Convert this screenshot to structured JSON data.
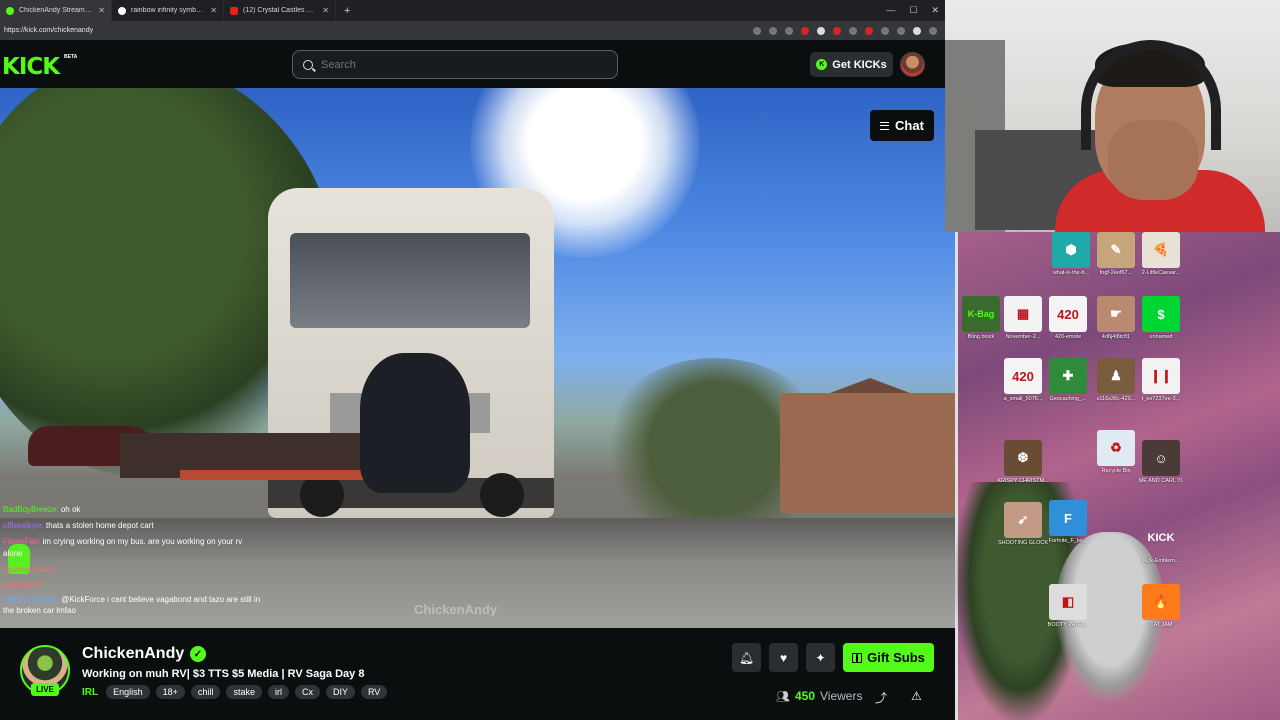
{
  "browser": {
    "tabs": [
      {
        "label": "ChickenAndy Stream - Watch",
        "active": true
      },
      {
        "label": "rainbow infinity symbol - Google",
        "active": false
      },
      {
        "label": "(12) Crystal Castles First Album M",
        "active": false
      }
    ],
    "url": "https://kick.com/chickenandy"
  },
  "header": {
    "logo": "KICK",
    "beta": "BETA",
    "search_placeholder": "Search",
    "get_kicks": "Get KICKs"
  },
  "player": {
    "chat_button": "Chat",
    "watermark": "ChickenAndy",
    "overlay_chat": [
      {
        "user": "BadBoyBreeze:",
        "msg": "oh ok"
      },
      {
        "user": "offbeatkyle:",
        "msg": "thats a stolen home depot cart"
      },
      {
        "user": "FlexieFae:",
        "msg": "im crying working on my bus. are you working on your rv alone"
      },
      {
        "user": "QuartaQuinco:",
        "msg": ""
      },
      {
        "user": "KoKoWOO:",
        "msg": ""
      },
      {
        "user": "SNEAKYWIND:",
        "msg": "@KickForce i cant believe vagabond and tazo are still in the broken car lmfao"
      }
    ]
  },
  "stream": {
    "live_badge": "LIVE",
    "streamer": "ChickenAndy",
    "title": "Working on muh RV| $3 TTS $5 Media | RV Saga Day 8",
    "category": "IRL",
    "tags": [
      "English",
      "18+",
      "chill",
      "stake",
      "irl",
      "Cx",
      "DIY",
      "RV"
    ],
    "gift_subs": "Gift Subs",
    "viewers_count": "450",
    "viewers_label": "Viewers"
  },
  "desktop": {
    "icons": [
      {
        "caption": "what-is-the-b...",
        "glyph": "⬢",
        "color": "#1fa9a9"
      },
      {
        "caption": "fogf-2eef67...",
        "glyph": "✎",
        "color": "#c7a57a"
      },
      {
        "caption": "2-LittleCaesar...",
        "glyph": "🍕",
        "color": "#e8e1d8"
      },
      {
        "caption": "Bling block",
        "glyph": "K-Bag",
        "color": "#3a6b2e"
      },
      {
        "caption": "November-2...",
        "glyph": "▦",
        "color": "#f3f3f3"
      },
      {
        "caption": "420-emote",
        "glyph": "420",
        "color": "#f4f4f4"
      },
      {
        "caption": "4d6j4t8tcft1",
        "glyph": "☛",
        "color": "#b98a6f"
      },
      {
        "caption": "unnamed",
        "glyph": "$",
        "color": "#00d632"
      },
      {
        "caption": "a_small_5076...",
        "glyph": "420",
        "color": "#f4f4f4"
      },
      {
        "caption": "Geocaching_...",
        "glyph": "✚",
        "color": "#2f8a3c"
      },
      {
        "caption": "s116s36c-420...",
        "glyph": "♟",
        "color": "#7a5c3e"
      },
      {
        "caption": "t_ee7237ee-3...",
        "glyph": "❙❙",
        "color": "#f2f2f2"
      },
      {
        "caption": "KRISPY CHRISTM...",
        "glyph": "❆",
        "color": "#6a4b34"
      },
      {
        "caption": "Recycle Bin",
        "glyph": "♻",
        "color": "#dfeaf2"
      },
      {
        "caption": "ME AND CARL !!1",
        "glyph": "☺",
        "color": "#4a3a38"
      },
      {
        "caption": "SHOOTING GLOCK",
        "glyph": "➹",
        "color": "#c39a86"
      },
      {
        "caption": "Fortnite_F_let...",
        "glyph": "F",
        "color": "#2f8fd8"
      },
      {
        "caption": "Kick-Emblem...",
        "glyph": "KICK",
        "color": "#ffffff"
      },
      {
        "caption": "BOOTY PATRI...",
        "glyph": "◧",
        "color": "#dddddd"
      },
      {
        "caption": "CAT JAM",
        "glyph": "🔥",
        "color": "#ff7a1a"
      }
    ]
  }
}
